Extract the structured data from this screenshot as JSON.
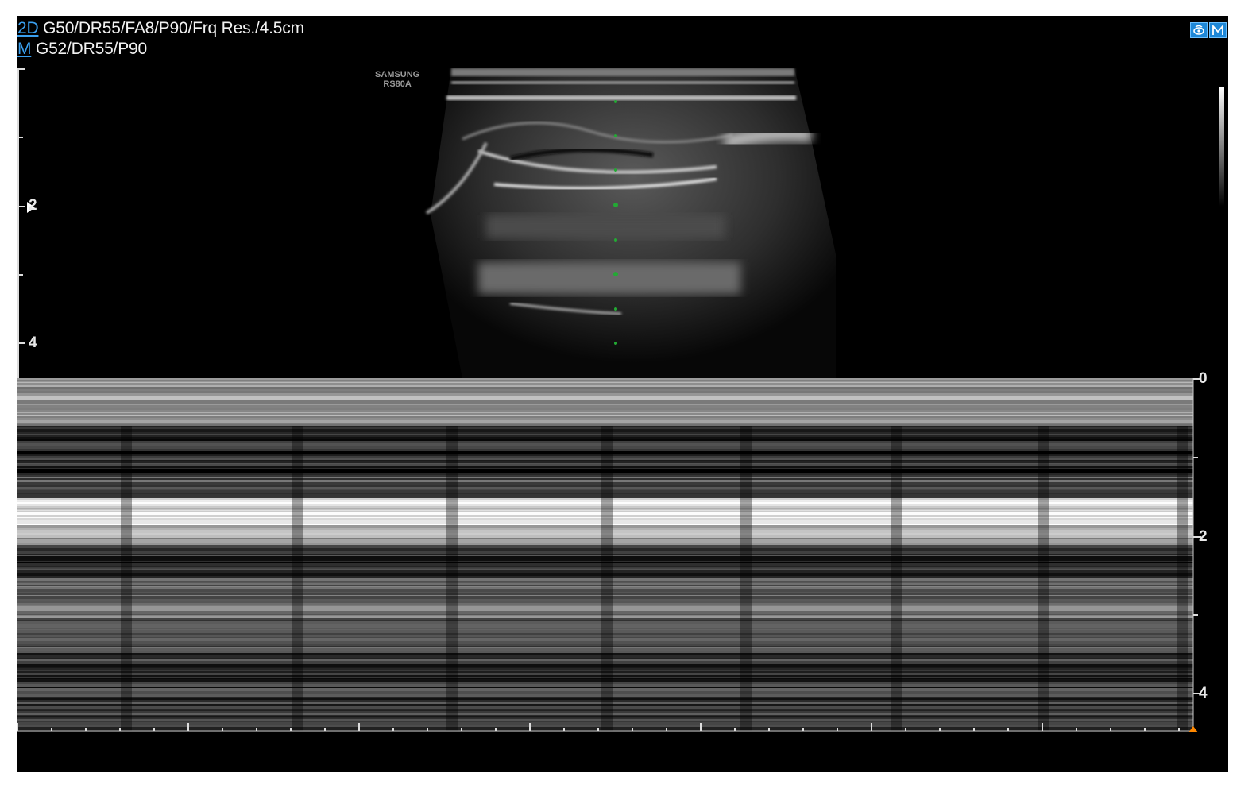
{
  "header": {
    "b_mode_label": "2D",
    "b_mode_params": "G50/DR55/FA8/P90/Frq Res./4.5cm",
    "m_mode_label": "M",
    "m_mode_params": "G52/DR55/P90"
  },
  "brand": {
    "line1": "SAMSUNG",
    "line2": "RS80A"
  },
  "icons": [
    "probe-icon",
    "m-mode-icon"
  ],
  "depth_scale_2d": {
    "labels": [
      "2",
      "4"
    ]
  },
  "depth_scale_m": {
    "labels": [
      "0",
      "2",
      "4"
    ]
  },
  "colors": {
    "mode_accent": "#3aa0f0",
    "icon_bg": "#1e88d8",
    "sample_points": "#22aa33",
    "marker": "#ff8800"
  }
}
